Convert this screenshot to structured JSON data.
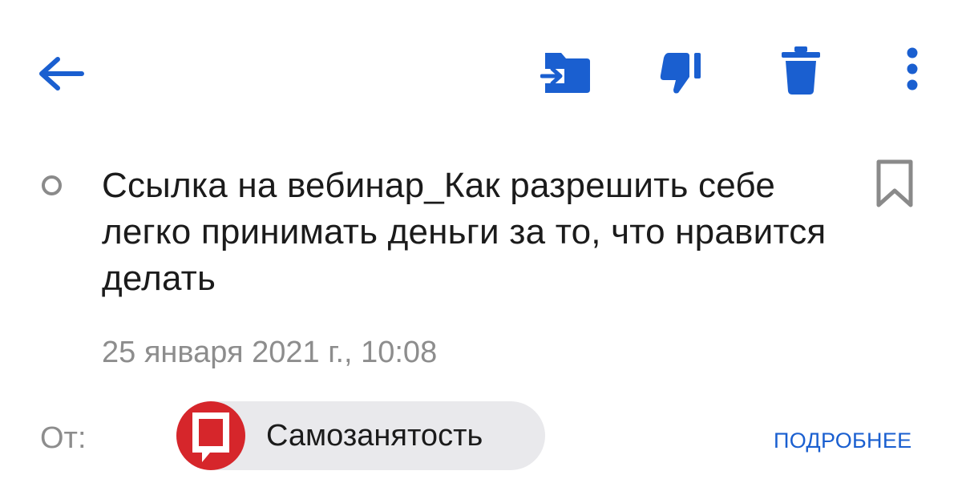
{
  "toolbar": {
    "icons": [
      "back-arrow-icon",
      "move-to-folder-icon",
      "spam-thumb-down-icon",
      "trash-icon",
      "more-vertical-icon"
    ],
    "accent_color": "#1a5fd0"
  },
  "message": {
    "subject": "Ссылка на вебинар_Как разрешить себе легко принимать деньги за то, что нравится делать",
    "date": "25 января 2021 г., 10:08",
    "from_label": "От:",
    "sender_name": "Самозанятость",
    "sender_avatar_color": "#d6262b",
    "details_link": "ПОДРОБНЕЕ"
  }
}
